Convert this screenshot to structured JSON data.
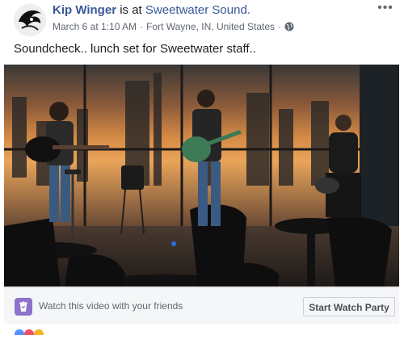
{
  "post": {
    "author": "Kip Winger",
    "action": "is at",
    "place": "Sweetwater Sound.",
    "date": "March 6 at 1:10 AM",
    "separator": "·",
    "location": "Fort Wayne, IN, United States",
    "separator2": "·",
    "privacy_icon": "globe-icon",
    "more_icon": "more-options-icon",
    "more_glyph": "•••",
    "text": "Soundcheck.. lunch set for Sweetwater staff.."
  },
  "watch_party": {
    "icon": "watch-party-popcorn-icon",
    "prompt": "Watch this video with your friends",
    "button_label": "Start Watch Party"
  },
  "colors": {
    "link": "#385898",
    "secondary_text": "#606770",
    "watch_party_icon_bg": "#8c72cb",
    "bar_bg": "#f5f6f7"
  }
}
